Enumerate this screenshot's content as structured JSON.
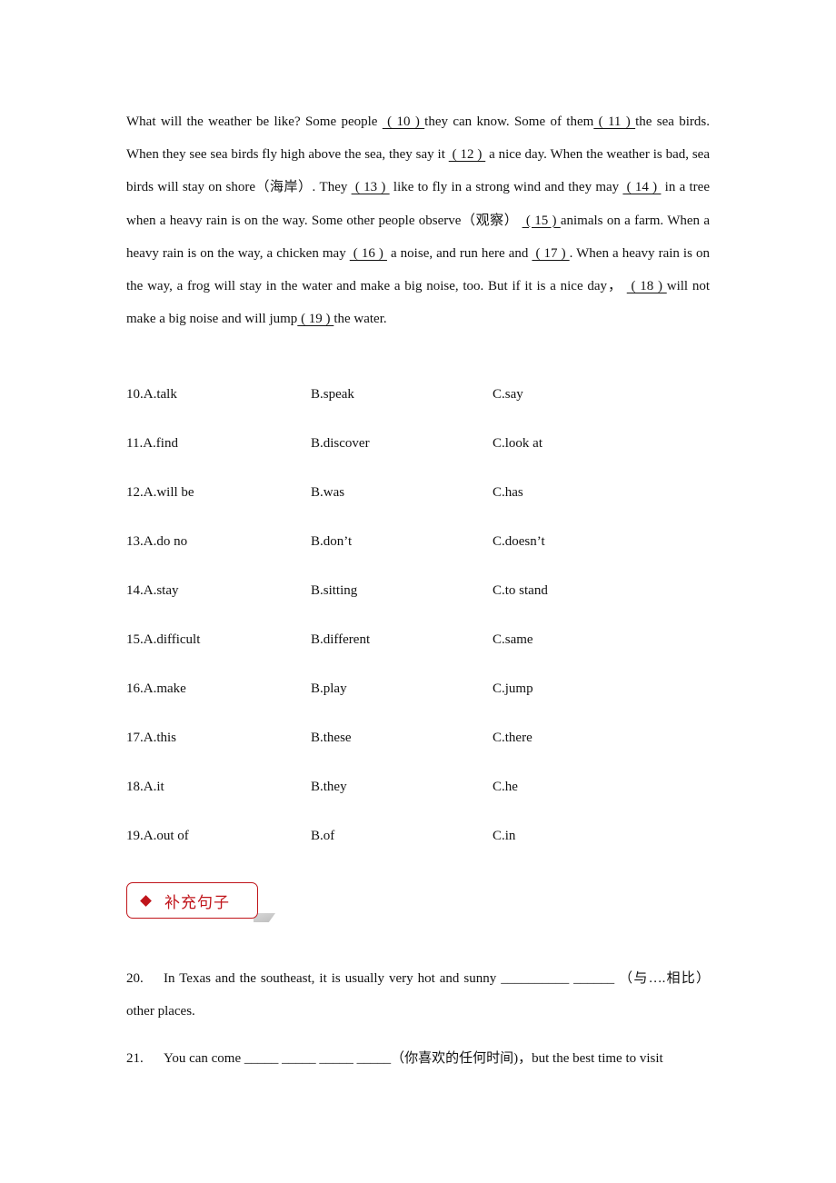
{
  "passage": {
    "segments": [
      {
        "t": "What will the weather be like? Some people "
      },
      {
        "b": " ( 10 ) "
      },
      {
        "t": "they can know. Some of them"
      },
      {
        "b": " ( 11 ) "
      },
      {
        "t": "the sea birds. When they see sea birds fly high above the sea, they say it "
      },
      {
        "b": " ( 12 ) "
      },
      {
        "t": " a nice day. When the weather is bad, sea birds will stay on shore（海岸）. They "
      },
      {
        "b": " ( 13 ) "
      },
      {
        "t": " like to fly in a strong wind and they may "
      },
      {
        "b": " ( 14 ) "
      },
      {
        "t": " in a tree when a heavy rain is on the way. Some other people observe（观察） "
      },
      {
        "b": " ( 15 ) "
      },
      {
        "t": "animals on a farm. When a heavy rain is on the way, a chicken may "
      },
      {
        "b": " ( 16 ) "
      },
      {
        "t": " a noise, and run here and "
      },
      {
        "b": " ( 17 ) "
      },
      {
        "t": ". When a heavy rain is on the way, a frog will stay in the water and make a big noise, too. But if it is a nice day， "
      },
      {
        "b": " ( 18 ) "
      },
      {
        "t": "will not make a big noise and will jump"
      },
      {
        "b": " ( 19 ) "
      },
      {
        "t": "the water."
      }
    ]
  },
  "options": [
    {
      "a": "10.A.talk",
      "b": "B.speak",
      "c": "C.say"
    },
    {
      "a": "11.A.find",
      "b": "B.discover",
      "c": "C.look at"
    },
    {
      "a": "12.A.will be",
      "b": "B.was",
      "c": "C.has"
    },
    {
      "a": "13.A.do no",
      "b": "B.don’t",
      "c": "C.doesn’t"
    },
    {
      "a": "14.A.stay",
      "b": "B.sitting",
      "c": "C.to stand"
    },
    {
      "a": "15.A.difficult",
      "b": "B.different",
      "c": "C.same"
    },
    {
      "a": "16.A.make",
      "b": "B.play",
      "c": "C.jump"
    },
    {
      "a": "17.A.this",
      "b": "B.these",
      "c": "C.there"
    },
    {
      "a": "18.A.it",
      "b": "B.they",
      "c": "C.he"
    },
    {
      "a": "19.A.out of",
      "b": "B.of",
      "c": "C.in"
    }
  ],
  "section": {
    "title": "补充句子",
    "icon": "diamond-icon",
    "accent_color": "#c0151b"
  },
  "questions": [
    {
      "num": "20.",
      "text": "In Texas and the southeast, it is usually very hot and sunny __________ ______  （与….相比）other places."
    },
    {
      "num": "21.",
      "text": "You can come _____ _____ _____ _____（你喜欢的任何时间)，but the best time to visit"
    }
  ]
}
